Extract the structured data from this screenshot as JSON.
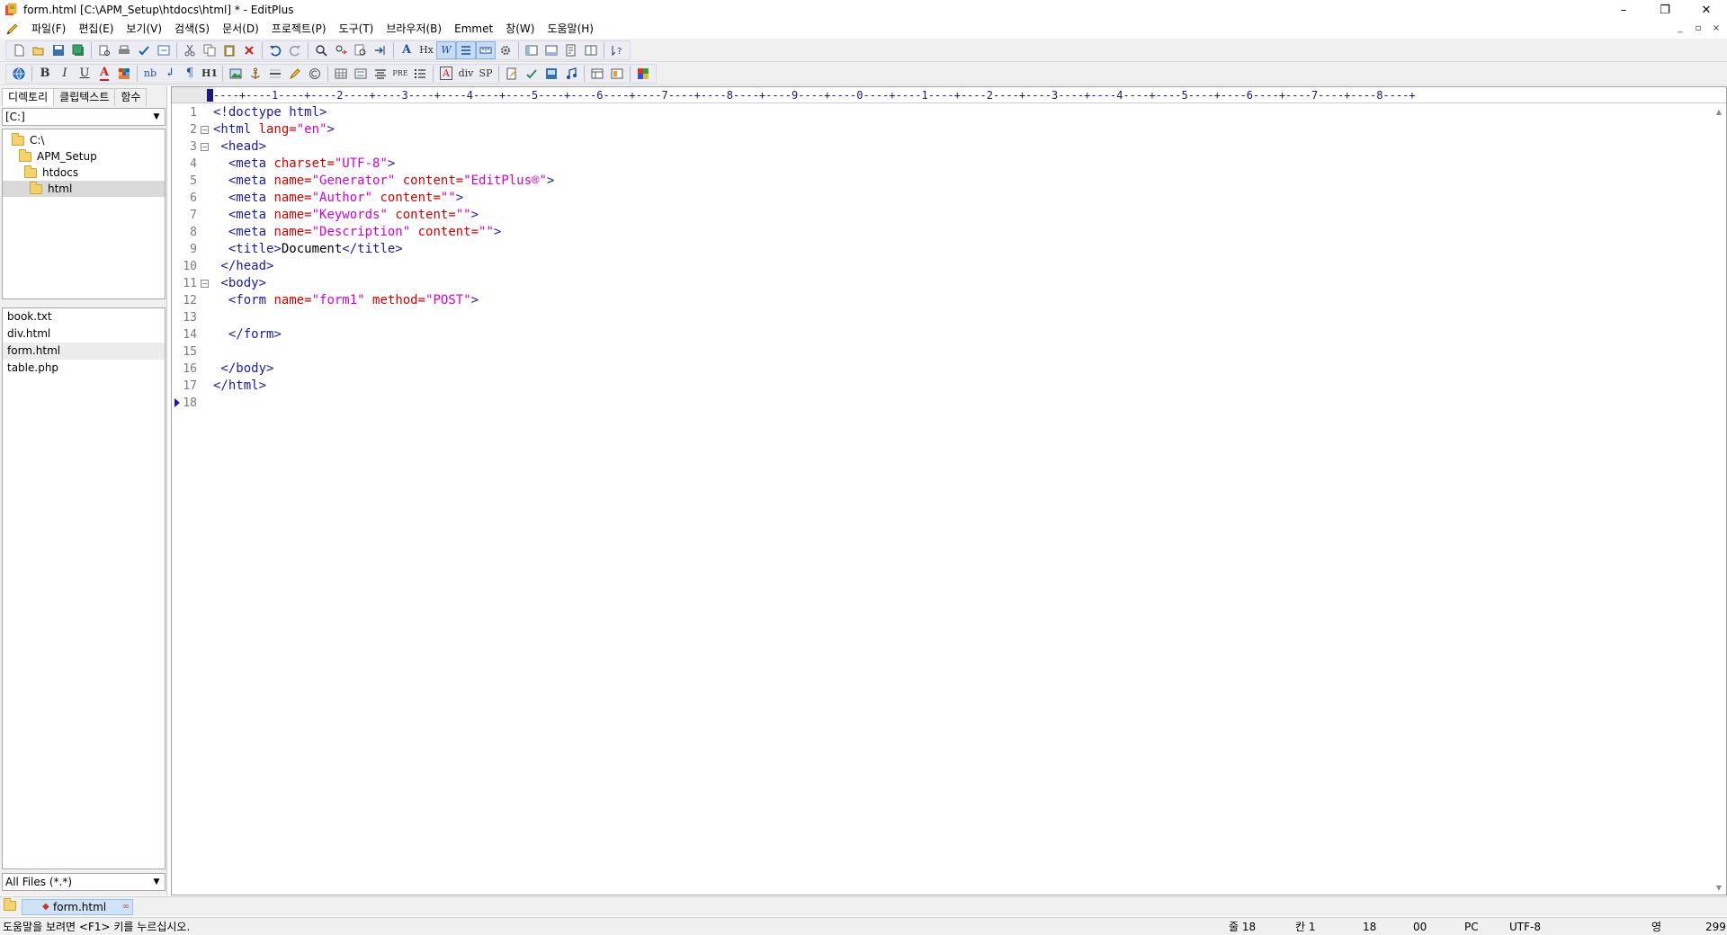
{
  "window": {
    "title": "form.html [C:\\APM_Setup\\htdocs\\html] * - EditPlus",
    "minimize": "–",
    "restore": "❐",
    "close": "✕"
  },
  "menu": [
    "파일(F)",
    "편집(E)",
    "보기(V)",
    "검색(S)",
    "문서(D)",
    "프로젝트(P)",
    "도구(T)",
    "브라우저(B)",
    "Emmet",
    "창(W)",
    "도움말(H)"
  ],
  "mdi": {
    "minimize": "_",
    "restore": "▫",
    "close": "×"
  },
  "toolbar2_text": {
    "bold": "B",
    "italic": "I",
    "underline": "U",
    "font": "A",
    "nbsp": "nb",
    "br": "↲",
    "para": "¶",
    "heading": "H1",
    "pre": "PRE",
    "div": "div",
    "sp": "SP"
  },
  "toolbar1_text": {
    "font_a": "A",
    "hx": "Hx",
    "word": "W"
  },
  "left_panel": {
    "tabs": [
      "디렉토리",
      "클립텍스트",
      "함수"
    ],
    "drive": "[C:]",
    "tree": [
      "C:\\",
      "APM_Setup",
      "htdocs",
      "html"
    ],
    "files": [
      "book.txt",
      "div.html",
      "form.html",
      "table.php"
    ],
    "filter": "All Files (*.*)"
  },
  "editor": {
    "ruler": "----+----1----+----2----+----3----+----4----+----5----+----6----+----7----+----8----+----9----+----0----+----1----+----2----+----3----+----4----+----5----+----6----+----7----+----8----+",
    "line_numbers": [
      "1",
      "2",
      "3",
      "4",
      "5",
      "6",
      "7",
      "8",
      "9",
      "10",
      "11",
      "12",
      "13",
      "14",
      "15",
      "16",
      "17",
      "18"
    ],
    "code": {
      "l1": "<!doctype html>",
      "l2_tag": "<html ",
      "l2_attr": "lang=",
      "l2_val": "\"en\"",
      "l2_end": ">",
      "l3": " <head>",
      "l4_tag": "  <meta ",
      "l4_attr": "charset=",
      "l4_val": "\"UTF-8\"",
      "l4_end": ">",
      "l5_tag": "  <meta ",
      "l5_attr": "name=",
      "l5_val": "\"Generator\"",
      "l5_attr2": " content=",
      "l5_val2": "\"EditPlus®\"",
      "l5_end": ">",
      "l6_tag": "  <meta ",
      "l6_attr": "name=",
      "l6_val": "\"Author\"",
      "l6_attr2": " content=",
      "l6_val2": "\"\"",
      "l6_end": ">",
      "l7_tag": "  <meta ",
      "l7_attr": "name=",
      "l7_val": "\"Keywords\"",
      "l7_attr2": " content=",
      "l7_val2": "\"\"",
      "l7_end": ">",
      "l8_tag": "  <meta ",
      "l8_attr": "name=",
      "l8_val": "\"Description\"",
      "l8_attr2": " content=",
      "l8_val2": "\"\"",
      "l8_end": ">",
      "l9_tag": "  <title>",
      "l9_txt": "Document",
      "l9_end": "</title>",
      "l10": " </head>",
      "l11": " <body>",
      "l12_tag": "  <form ",
      "l12_attr": "name=",
      "l12_val": "\"form1\"",
      "l12_attr2": " method=",
      "l12_val2": "\"POST\"",
      "l12_end": ">",
      "l14": "  </form>",
      "l16": " </body>",
      "l17": "</html>"
    }
  },
  "doc_tab": {
    "label": "form.html",
    "modified_mark": "◆",
    "close": "∞"
  },
  "status": {
    "message": "도움말을 보려면 <F1> 키를 누르십시오.",
    "line": "줄 18",
    "col": "칸 1",
    "total": "18",
    "hex": "00",
    "eol": "PC",
    "encoding": "UTF-8",
    "ime": "영",
    "size": "299"
  }
}
